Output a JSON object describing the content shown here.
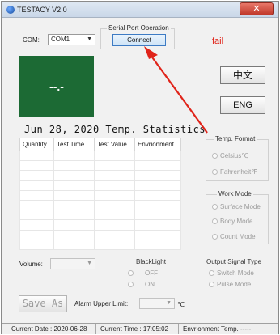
{
  "window": {
    "title": "TESTACY   V2.0",
    "close": "✕"
  },
  "com": {
    "label": "COM:",
    "value": "COM1"
  },
  "serial": {
    "group_label": "Serial Port Operation",
    "connect_label": "Connect",
    "status": "fail"
  },
  "display": {
    "value": "--.-"
  },
  "language": {
    "chinese_label": "中文",
    "english_label": "ENG"
  },
  "stats": {
    "title": "Jun 28, 2020 Temp. Statistics",
    "columns": [
      "Quantity",
      "Test Time",
      "Test Value",
      "Envrionment"
    ]
  },
  "temp_format": {
    "title": "Temp. Format",
    "options": [
      "Celsius℃",
      "Fahrenheit℉"
    ]
  },
  "work_mode": {
    "title": "Work Mode",
    "options": [
      "Surface Mode",
      "Body Mode",
      "Count Mode"
    ]
  },
  "volume": {
    "label": "Volume:"
  },
  "backlight": {
    "title": "BlackLight",
    "options": [
      "OFF",
      "ON"
    ]
  },
  "output_signal": {
    "title": "Output Signal Type",
    "options": [
      "Switch Mode",
      "Pulse Mode"
    ]
  },
  "save_as": {
    "label": "Save As"
  },
  "alarm": {
    "label": "Alarm Upper Limit:",
    "unit": "℃"
  },
  "status_bar": {
    "current_date": "Current Date : 2020-06-28",
    "current_time": "Current Time : 17:05:02",
    "env_temp": "Envrionment Temp.  -----"
  },
  "colors": {
    "display_bg": "#1c6a34",
    "fail": "#e0241a",
    "arrow": "#e0241a"
  }
}
